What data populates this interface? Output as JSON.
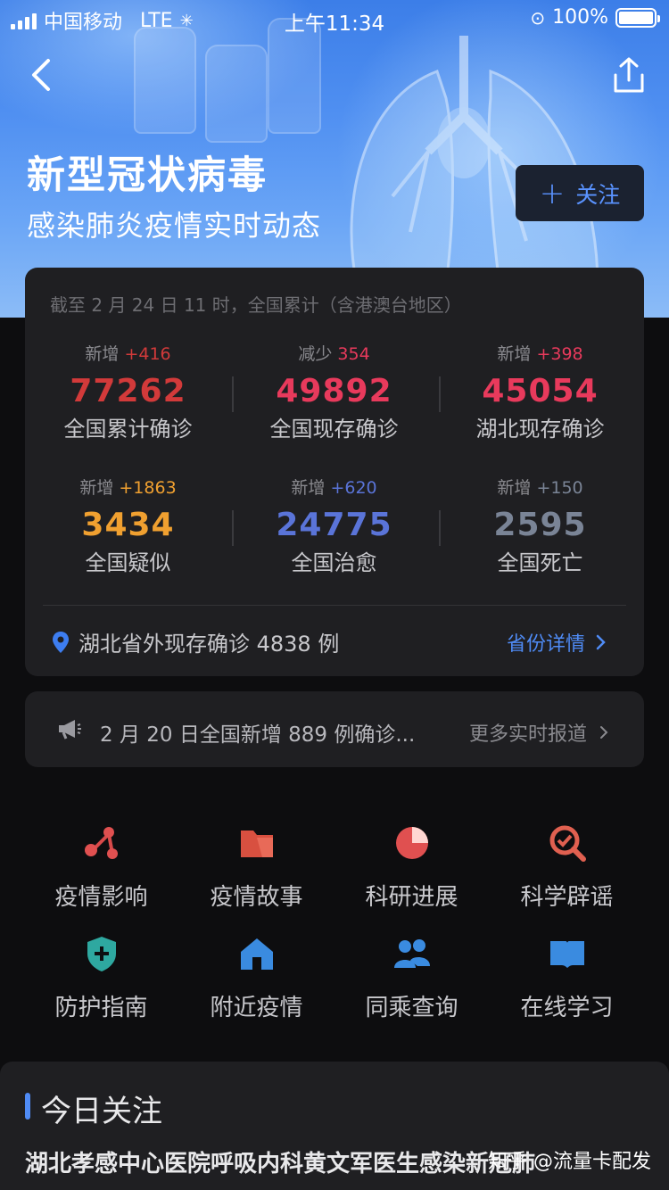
{
  "status_bar": {
    "carrier": "中国移动",
    "network": "LTE",
    "time": "上午11:34",
    "battery": "100%",
    "battery_level": 1.0
  },
  "header": {
    "title": "新型冠状病毒",
    "subtitle": "感染肺炎疫情实时动态",
    "follow_label": "关注"
  },
  "stats": {
    "note": "截至 2 月 24 日 11 时，全国累计（含港澳台地区）",
    "items": [
      {
        "delta_label": "新增",
        "delta_value": "+416",
        "value": "77262",
        "label": "全国累计确诊",
        "color": "#d23a3a"
      },
      {
        "delta_label": "减少",
        "delta_value": "354",
        "value": "49892",
        "label": "全国现存确诊",
        "color": "#e83a5c"
      },
      {
        "delta_label": "新增",
        "delta_value": "+398",
        "value": "45054",
        "label": "湖北现存确诊",
        "color": "#e83a5c"
      },
      {
        "delta_label": "新增",
        "delta_value": "+1863",
        "value": "3434",
        "label": "全国疑似",
        "color": "#f0a030"
      },
      {
        "delta_label": "新增",
        "delta_value": "+620",
        "value": "24775",
        "label": "全国治愈",
        "color": "#5a74d8"
      },
      {
        "delta_label": "新增",
        "delta_value": "+150",
        "value": "2595",
        "label": "全国死亡",
        "color": "#7a8496"
      }
    ],
    "outside_hubei": "湖北省外现存确诊 4838 例",
    "detail_link": "省份详情"
  },
  "news": {
    "text": "2 月 20 日全国新增 889 例确诊...",
    "more": "更多实时报道"
  },
  "features": [
    {
      "label": "疫情影响",
      "icon": "network-icon"
    },
    {
      "label": "疫情故事",
      "icon": "folder-icon"
    },
    {
      "label": "科研进展",
      "icon": "pie-chart-icon"
    },
    {
      "label": "科学辟谣",
      "icon": "magnify-check-icon"
    },
    {
      "label": "防护指南",
      "icon": "shield-plus-icon"
    },
    {
      "label": "附近疫情",
      "icon": "home-icon"
    },
    {
      "label": "同乘查询",
      "icon": "people-icon"
    },
    {
      "label": "在线学习",
      "icon": "book-icon"
    }
  ],
  "today": {
    "heading": "今日关注",
    "headline": "湖北孝感中心医院呼吸内科黄文军医生感染新冠肺"
  },
  "watermark": "知乎 @流量卡配发"
}
